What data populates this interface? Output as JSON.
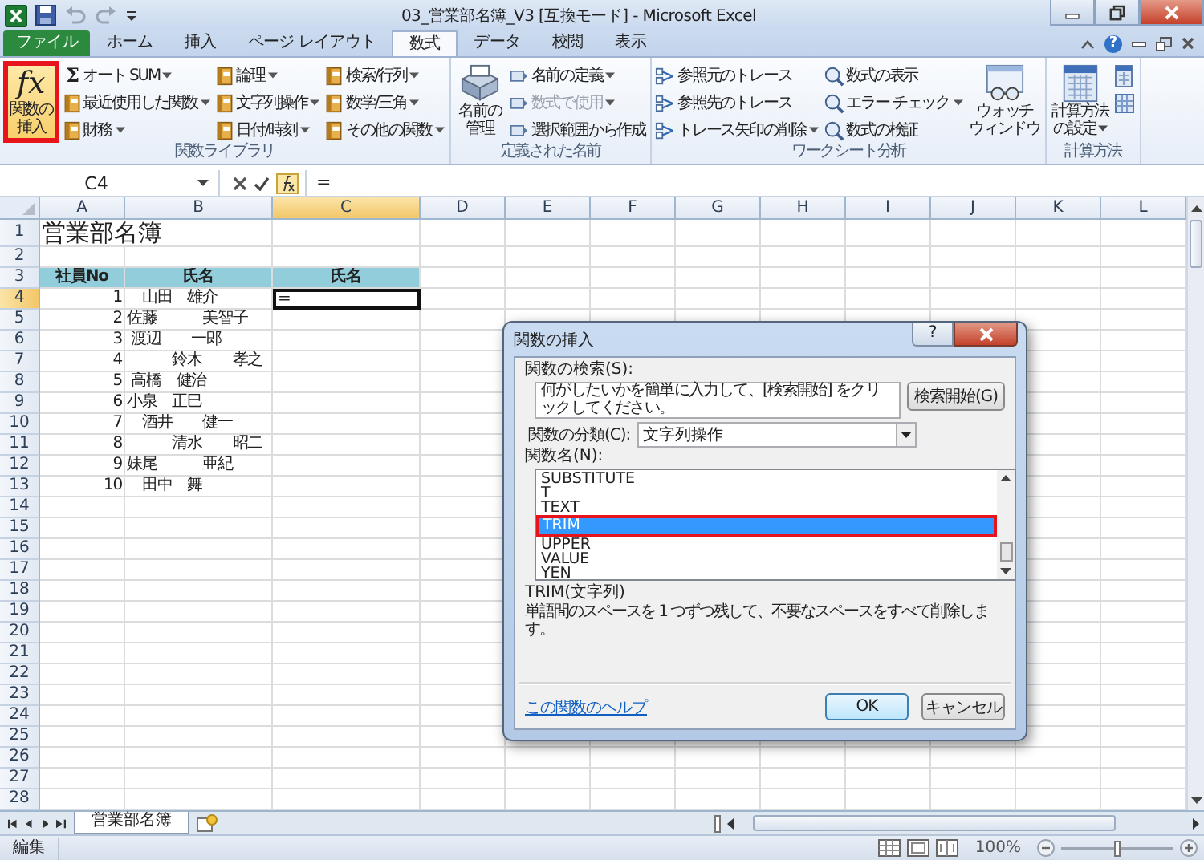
{
  "window": {
    "title": "03_営業部名簿_V3  [互換モード] - Microsoft Excel"
  },
  "tabs": [
    {
      "label": "ファイル",
      "kind": "file",
      "selected": false
    },
    {
      "label": "ホーム",
      "kind": "tab",
      "selected": false
    },
    {
      "label": "挿入",
      "kind": "tab",
      "selected": false
    },
    {
      "label": "ページ レイアウト",
      "kind": "tab",
      "selected": false
    },
    {
      "label": "数式",
      "kind": "tab",
      "selected": true
    },
    {
      "label": "データ",
      "kind": "tab",
      "selected": false
    },
    {
      "label": "校閲",
      "kind": "tab",
      "selected": false
    },
    {
      "label": "表示",
      "kind": "tab",
      "selected": false
    }
  ],
  "ribbon_help": "?",
  "ribbon": {
    "groups": [
      {
        "label": "関数ライブラリ",
        "blocks": [
          {
            "kind": "fx",
            "symbol": "fx",
            "lines": [
              "関数の",
              "挿入"
            ],
            "dropdown": false,
            "highlighted": true
          },
          {
            "kind": "column",
            "items": [
              {
                "label": "オート SUM",
                "kind": "sigma",
                "symbol": "Σ",
                "dropdown": true,
                "disabled": false
              },
              {
                "label": "最近使用した関数",
                "kind": "book",
                "dropdown": true,
                "disabled": false
              },
              {
                "label": "財務",
                "kind": "book",
                "dropdown": true,
                "disabled": false
              }
            ]
          },
          {
            "kind": "column",
            "items": [
              {
                "label": "論理",
                "kind": "book",
                "dropdown": true,
                "disabled": false
              },
              {
                "label": "文字列操作",
                "kind": "book",
                "dropdown": true,
                "disabled": false
              },
              {
                "label": "日付/時刻",
                "kind": "book",
                "dropdown": true,
                "disabled": false
              }
            ]
          },
          {
            "kind": "column",
            "items": [
              {
                "label": "検索/行列",
                "kind": "book",
                "dropdown": true,
                "disabled": false
              },
              {
                "label": "数学/三角",
                "kind": "book",
                "dropdown": true,
                "disabled": false
              },
              {
                "label": "その他の関数",
                "kind": "book",
                "dropdown": true,
                "disabled": false
              }
            ]
          }
        ]
      },
      {
        "label": "定義された名前",
        "blocks": [
          {
            "kind": "names",
            "lines": [
              "名前の",
              "管理"
            ],
            "dropdown": false,
            "highlighted": false
          },
          {
            "kind": "column",
            "items": [
              {
                "label": "名前の定義",
                "kind": "tag",
                "dropdown": true,
                "disabled": false
              },
              {
                "label": "数式で使用",
                "kind": "tag",
                "dropdown": true,
                "disabled": true
              },
              {
                "label": "選択範囲から作成",
                "kind": "tag",
                "dropdown": false,
                "disabled": false
              }
            ]
          }
        ]
      },
      {
        "label": "ワークシート分析",
        "blocks": [
          {
            "kind": "column",
            "items": [
              {
                "label": "参照元のトレース",
                "kind": "trace",
                "dropdown": false,
                "disabled": false
              },
              {
                "label": "参照先のトレース",
                "kind": "trace",
                "dropdown": false,
                "disabled": false
              },
              {
                "label": "トレース矢印の削除",
                "kind": "trace",
                "dropdown": true,
                "disabled": false
              }
            ]
          },
          {
            "kind": "column",
            "items": [
              {
                "label": "数式の表示",
                "kind": "check",
                "dropdown": false,
                "disabled": false
              },
              {
                "label": "エラー チェック",
                "kind": "check",
                "dropdown": true,
                "disabled": false
              },
              {
                "label": "数式の検証",
                "kind": "check",
                "dropdown": false,
                "disabled": false
              }
            ]
          },
          {
            "kind": "watch",
            "lines": [
              "ウォッチ",
              "ウィンドウ"
            ],
            "dropdown": false,
            "highlighted": false
          }
        ]
      },
      {
        "label": "計算方法",
        "blocks": [
          {
            "kind": "calc",
            "lines": [
              "計算方法",
              "の設定"
            ],
            "dropdown": true,
            "highlighted": false
          },
          {
            "kind": "column",
            "items": [
              {
                "kind": "calc",
                "dropdown": false,
                "disabled": false
              },
              {
                "kind": "sheet",
                "dropdown": false,
                "disabled": false
              }
            ]
          }
        ]
      }
    ]
  },
  "formula_bar": {
    "name_box": "C4",
    "value": "="
  },
  "sheet": {
    "columns": [
      {
        "label": "A",
        "selected": false
      },
      {
        "label": "B",
        "selected": false
      },
      {
        "label": "C",
        "selected": true
      },
      {
        "label": "D",
        "selected": false
      },
      {
        "label": "E",
        "selected": false
      },
      {
        "label": "F",
        "selected": false
      },
      {
        "label": "G",
        "selected": false
      },
      {
        "label": "H",
        "selected": false
      },
      {
        "label": "I",
        "selected": false
      },
      {
        "label": "J",
        "selected": false
      },
      {
        "label": "K",
        "selected": false
      },
      {
        "label": "L",
        "selected": false
      }
    ],
    "rows": [
      {
        "number": "1",
        "kind": "title",
        "selected": false,
        "cells": [
          "営業部名簿"
        ]
      },
      {
        "number": "2",
        "kind": "empty",
        "selected": false
      },
      {
        "number": "3",
        "kind": "header",
        "selected": false,
        "cells": [
          "社員No",
          "氏名",
          "氏名"
        ]
      },
      {
        "number": "4",
        "kind": "data",
        "selected": true,
        "cells": [
          "1",
          "　山田　雄介",
          "="
        ]
      },
      {
        "number": "5",
        "kind": "data",
        "selected": false,
        "cells": [
          "2",
          "佐藤　　　美智子"
        ]
      },
      {
        "number": "6",
        "kind": "data",
        "selected": false,
        "cells": [
          "3",
          " 渡辺　　一郎"
        ]
      },
      {
        "number": "7",
        "kind": "data",
        "selected": false,
        "cells": [
          "4",
          "　　　鈴木　　孝之"
        ]
      },
      {
        "number": "8",
        "kind": "data",
        "selected": false,
        "cells": [
          "5",
          " 高橋　健治"
        ]
      },
      {
        "number": "9",
        "kind": "data",
        "selected": false,
        "cells": [
          "6",
          "小泉　正巳"
        ]
      },
      {
        "number": "10",
        "kind": "data",
        "selected": false,
        "cells": [
          "7",
          "　酒井　　健一"
        ]
      },
      {
        "number": "11",
        "kind": "data",
        "selected": false,
        "cells": [
          "8",
          "　　　清水　　昭二"
        ]
      },
      {
        "number": "12",
        "kind": "data",
        "selected": false,
        "cells": [
          "9",
          "妹尾　　　亜紀"
        ]
      },
      {
        "number": "13",
        "kind": "data",
        "selected": false,
        "cells": [
          "10",
          "　田中　舞"
        ]
      },
      {
        "number": "14",
        "kind": "empty",
        "selected": false
      },
      {
        "number": "15",
        "kind": "empty",
        "selected": false
      },
      {
        "number": "16",
        "kind": "empty",
        "selected": false
      },
      {
        "number": "17",
        "kind": "empty",
        "selected": false
      },
      {
        "number": "18",
        "kind": "empty",
        "selected": false
      },
      {
        "number": "19",
        "kind": "empty",
        "selected": false
      },
      {
        "number": "20",
        "kind": "empty",
        "selected": false
      },
      {
        "number": "21",
        "kind": "empty",
        "selected": false
      },
      {
        "number": "22",
        "kind": "empty",
        "selected": false
      },
      {
        "number": "23",
        "kind": "empty",
        "selected": false
      },
      {
        "number": "24",
        "kind": "empty",
        "selected": false
      },
      {
        "number": "25",
        "kind": "empty",
        "selected": false
      },
      {
        "number": "26",
        "kind": "empty",
        "selected": false
      },
      {
        "number": "27",
        "kind": "empty",
        "selected": false
      },
      {
        "number": "28",
        "kind": "empty",
        "selected": false
      }
    ]
  },
  "dialog": {
    "title": "関数の挿入",
    "help": "?",
    "search_label": "関数の検索(S):",
    "search_value": "何がしたいかを簡単に入力して、[検索開始] をクリックしてください。",
    "search_button": "検索開始(G)",
    "category_label": "関数の分類(C):",
    "category_value": "文字列操作",
    "list_label": "関数名(N):",
    "functions": [
      {
        "name": "SUBSTITUTE",
        "selected": false,
        "highlighted": false
      },
      {
        "name": "T",
        "selected": false,
        "highlighted": false
      },
      {
        "name": "TEXT",
        "selected": false,
        "highlighted": false
      },
      {
        "name": "TRIM",
        "selected": true,
        "highlighted": true
      },
      {
        "name": "UPPER",
        "selected": false,
        "highlighted": false
      },
      {
        "name": "VALUE",
        "selected": false,
        "highlighted": false
      },
      {
        "name": "YEN",
        "selected": false,
        "highlighted": false
      }
    ],
    "signature": "TRIM(文字列)",
    "description": "単語間のスペースを 1 つずつ残して、不要なスペースをすべて削除します。",
    "help_link": "この関数のヘルプ",
    "buttons": [
      {
        "label": "OK",
        "kind": "default"
      },
      {
        "label": "キャンセル",
        "kind": "normal"
      }
    ]
  },
  "sheet_tabs": [
    {
      "label": "営業部名簿",
      "selected": true
    }
  ],
  "status_bar": {
    "mode": "編集",
    "zoom": "100%",
    "zoom_slider": {
      "level": 0.5
    }
  }
}
